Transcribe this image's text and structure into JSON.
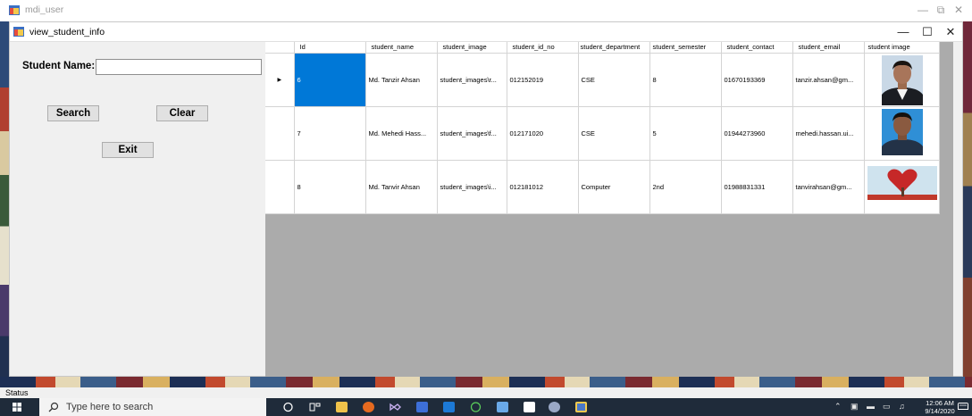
{
  "outer_window": {
    "title": "mdi_user"
  },
  "child_window": {
    "title": "view_student_info"
  },
  "form": {
    "student_name_label": "Student Name:",
    "student_name_value": "",
    "search_label": "Search",
    "clear_label": "Clear",
    "exit_label": "Exit"
  },
  "grid": {
    "columns": [
      "Id",
      "student_name",
      "student_image",
      "student_id_no",
      "student_department",
      "student_semester",
      "student_contact",
      "student_email",
      "student image"
    ],
    "rows": [
      {
        "current": true,
        "id": "6",
        "student_name": "Md. Tanzir Ahsan",
        "student_image": "student_images\\r...",
        "student_id_no": "012152019",
        "student_department": "CSE",
        "student_semester": "8",
        "student_contact": "01670193369",
        "student_email": "tanzir.ahsan@gm...",
        "photo": "student-portrait-photo"
      },
      {
        "current": false,
        "id": "7",
        "student_name": "Md. Mehedi Hass...",
        "student_image": "student_images\\f...",
        "student_id_no": "012171020",
        "student_department": "CSE",
        "student_semester": "5",
        "student_contact": "01944273960",
        "student_email": "mehedi.hassan.ui...",
        "photo": "student-portrait-photo"
      },
      {
        "current": false,
        "id": "8",
        "student_name": "Md. Tanvir Ahsan",
        "student_image": "student_images\\i...",
        "student_id_no": "012181012",
        "student_department": "Computer",
        "student_semester": "2nd",
        "student_contact": "01988831331",
        "student_email": "tanvirahsan@gm...",
        "photo": "heart-tree-photo"
      }
    ],
    "selection_color": "#0078d7"
  },
  "status": {
    "text": "Status"
  },
  "taskbar": {
    "search_placeholder": "Type here to search",
    "time": "12:06 AM",
    "date": "9/14/2020",
    "icons": [
      "start-icon",
      "cortana-icon",
      "task-view-icon",
      "file-explorer-icon",
      "firefox-icon",
      "visual-studio-icon",
      "app-icon",
      "outlook-icon",
      "upwork-icon",
      "app-icon",
      "notepad-icon",
      "paint-icon",
      "winforms-app-icon"
    ]
  }
}
